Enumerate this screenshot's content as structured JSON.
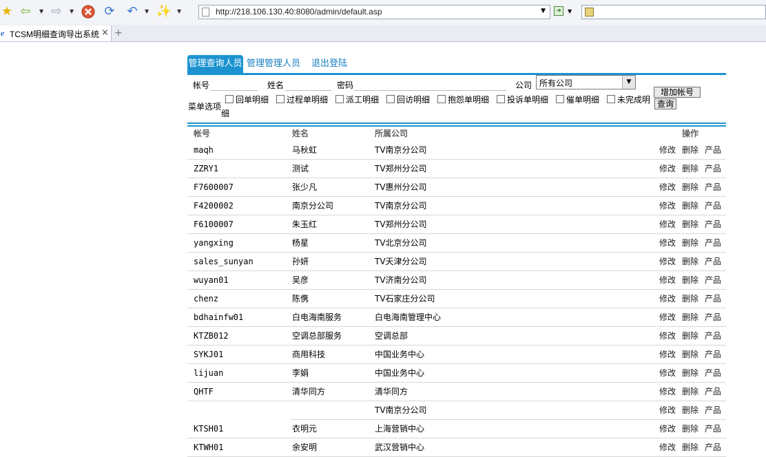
{
  "browser": {
    "url": "http://218.106.130.40:8080/admin/default.asp",
    "tab_title": "TCSM明细查询导出系统",
    "new_tab_symbol": "+",
    "close_symbol": "×",
    "icons": [
      "favorites-star-icon",
      "back-icon",
      "forward-icon",
      "stop-icon",
      "refresh-icon",
      "undo-icon",
      "tools-wand-icon",
      "page-icon",
      "go-icon",
      "search-provider-icon"
    ]
  },
  "nav": {
    "tabs": [
      {
        "label": "管理查询人员",
        "active": true
      },
      {
        "label": "管理管理人员",
        "active": false
      },
      {
        "label": "退出登陆",
        "active": false
      }
    ]
  },
  "form": {
    "account_label": "帐号",
    "name_label": "姓名",
    "password_label": "密码",
    "company_label": "公司",
    "company_selected": "所有公司",
    "add_button": "增加帐号",
    "query_button": "查询",
    "menu_label_1": "菜单选项",
    "menu_label_2": "细",
    "menu_options": [
      "回单明细",
      "过程单明细",
      "派工明细",
      "回访明细",
      "抱怨单明细",
      "投诉单明细",
      "催单明细",
      "未完成明"
    ]
  },
  "table": {
    "headers": {
      "account": "帐号",
      "name": "姓名",
      "company": "所属公司",
      "actions": "操作"
    },
    "action_labels": {
      "edit": "修改",
      "delete": "删除",
      "product": "产品"
    },
    "rows": [
      {
        "account": "maqh",
        "name": "马秋虹",
        "company": "TV南京分公司"
      },
      {
        "account": "ZZRY1",
        "name": "测试",
        "company": "TV郑州分公司"
      },
      {
        "account": "F7600007",
        "name": "张少凡",
        "company": "TV惠州分公司"
      },
      {
        "account": "F4200002",
        "name": "南京分公司",
        "company": "TV南京分公司"
      },
      {
        "account": "F6100007",
        "name": "朱玉红",
        "company": "TV郑州分公司"
      },
      {
        "account": "yangxing",
        "name": "杨星",
        "company": "TV北京分公司"
      },
      {
        "account": "sales_sunyan",
        "name": "孙妍",
        "company": "TV天津分公司"
      },
      {
        "account": "wuyan01",
        "name": "吴彦",
        "company": "TV济南分公司"
      },
      {
        "account": "chenz",
        "name": "陈㑺",
        "company": "TV石家庄分公司"
      },
      {
        "account": "bdhainfw01",
        "name": "白电海南服务",
        "company": "白电海南管理中心"
      },
      {
        "account": "KTZB012",
        "name": "空调总部服务",
        "company": "空调总部"
      },
      {
        "account": "SYKJ01",
        "name": "商用科技",
        "company": "中国业务中心"
      },
      {
        "account": "lijuan",
        "name": "李娟",
        "company": "中国业务中心"
      },
      {
        "account": "QHTF",
        "name": "清华同方",
        "company": "清华同方"
      },
      {
        "account": "",
        "name": "",
        "company": "TV南京分公司"
      },
      {
        "account": "KTSH01",
        "name": "衣明元",
        "company": "上海营销中心"
      },
      {
        "account": "KTWH01",
        "name": "余安明",
        "company": "武汉营销中心"
      }
    ]
  },
  "colors": {
    "accent": "#1c93d0",
    "link": "#1a7fc2"
  }
}
